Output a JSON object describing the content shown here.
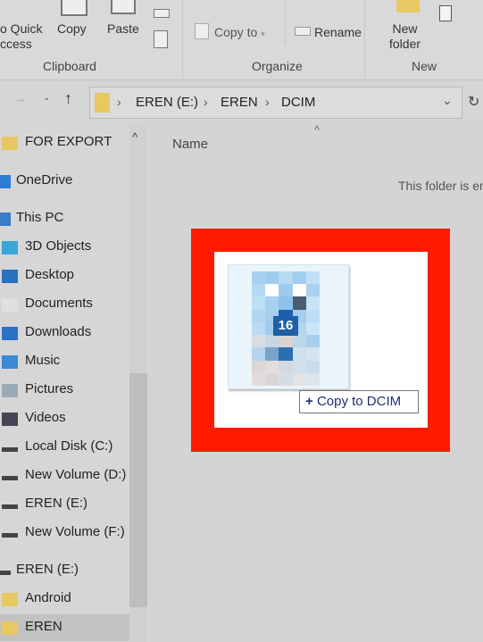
{
  "ribbon": {
    "pin_label_1": "o Quick",
    "pin_label_2": "ccess",
    "copy": "Copy",
    "paste": "Paste",
    "copy_to": "Copy to",
    "rename": "Rename",
    "new_folder_1": "New",
    "new_folder_2": "folder",
    "groups": {
      "clipboard": "Clipboard",
      "organize": "Organize",
      "new": "New"
    }
  },
  "address": {
    "crumbs": [
      "EREN (E:)",
      "EREN",
      "DCIM"
    ]
  },
  "sidebar": {
    "items": [
      {
        "label": "FOR EXPORT",
        "icon": "folder-icon"
      },
      {
        "label": "OneDrive",
        "icon": "cloud-icon"
      },
      {
        "label": "This PC",
        "icon": "computer-icon"
      },
      {
        "label": "3D Objects",
        "icon": "cube-icon"
      },
      {
        "label": "Desktop",
        "icon": "desktop-icon"
      },
      {
        "label": "Documents",
        "icon": "document-icon"
      },
      {
        "label": "Downloads",
        "icon": "download-icon"
      },
      {
        "label": "Music",
        "icon": "music-icon"
      },
      {
        "label": "Pictures",
        "icon": "pictures-icon"
      },
      {
        "label": "Videos",
        "icon": "video-icon"
      },
      {
        "label": "Local Disk (C:)",
        "icon": "drive-icon"
      },
      {
        "label": "New Volume (D:)",
        "icon": "drive-icon"
      },
      {
        "label": "EREN (E:)",
        "icon": "drive-icon"
      },
      {
        "label": "New Volume (F:)",
        "icon": "drive-icon"
      },
      {
        "label": "EREN (E:)",
        "icon": "drive-icon"
      },
      {
        "label": "Android",
        "icon": "folder-icon"
      },
      {
        "label": "EREN",
        "icon": "folder-icon",
        "selected": true
      }
    ]
  },
  "content": {
    "column_name": "Name",
    "empty_message": "This folder is empty."
  },
  "drag": {
    "count": "16",
    "tooltip": "Copy to DCIM"
  },
  "colors": {
    "highlight": "#ff1a00",
    "badge": "#1d5fa8",
    "tooltip_text": "#1f2f73"
  }
}
